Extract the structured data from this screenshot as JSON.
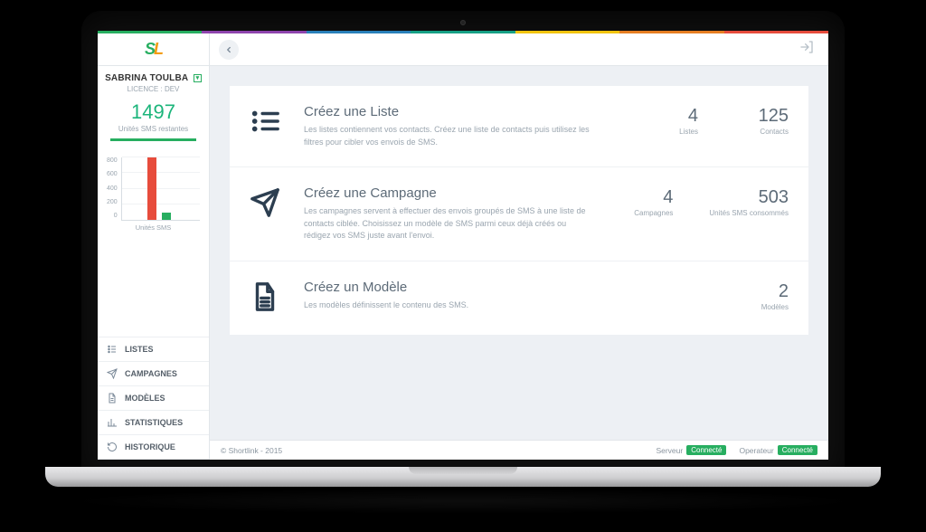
{
  "stripe_colors": [
    "#27ae60",
    "#8e44ad",
    "#2980b9",
    "#16a085",
    "#f1c40f",
    "#e67e22",
    "#e74c3c"
  ],
  "header": {
    "logo_text_1": "S",
    "logo_text_2": "L"
  },
  "sidebar": {
    "user_name": "SABRINA TOULBA",
    "user_role": "LICENCE : DEV",
    "units_value": "1497",
    "units_label": "Unités SMS restantes",
    "chart_caption": "Unités SMS",
    "nav": [
      {
        "label": "LISTES"
      },
      {
        "label": "CAMPAGNES"
      },
      {
        "label": "MODÈLES"
      },
      {
        "label": "STATISTIQUES"
      },
      {
        "label": "HISTORIQUE"
      }
    ]
  },
  "chart_data": {
    "type": "bar",
    "title": "Unités SMS",
    "xlabel": "",
    "ylabel": "",
    "ylim": [
      0,
      800
    ],
    "y_ticks": [
      800,
      600,
      400,
      200,
      0
    ],
    "series": [
      {
        "name": "red",
        "color": "#e74c3c",
        "values": [
          800
        ]
      },
      {
        "name": "green",
        "color": "#27ae60",
        "values": [
          90
        ]
      }
    ]
  },
  "cards": [
    {
      "icon": "list",
      "title": "Créez une Liste",
      "desc": "Les listes contiennent vos contacts. Créez une liste de contacts puis utilisez les filtres pour cibler vos envois de SMS.",
      "stats": [
        {
          "value": "4",
          "label": "Listes"
        },
        {
          "value": "125",
          "label": "Contacts"
        }
      ]
    },
    {
      "icon": "send",
      "title": "Créez une Campagne",
      "desc": "Les campagnes servent à effectuer des envois groupés de SMS à une liste de contacts ciblée. Choisissez un modèle de SMS parmi ceux déjà créés ou rédigez vos SMS juste avant l'envoi.",
      "stats": [
        {
          "value": "4",
          "label": "Campagnes"
        },
        {
          "value": "503",
          "label": "Unités SMS consommés"
        }
      ]
    },
    {
      "icon": "file",
      "title": "Créez un Modèle",
      "desc": "Les modèles définissent le contenu des SMS.",
      "stats": [
        {
          "value": "2",
          "label": "Modèles"
        }
      ]
    }
  ],
  "footer": {
    "copyright": "© Shortlink - 2015",
    "server_label": "Serveur",
    "server_status": "Connecté",
    "operator_label": "Operateur",
    "operator_status": "Connecté"
  }
}
